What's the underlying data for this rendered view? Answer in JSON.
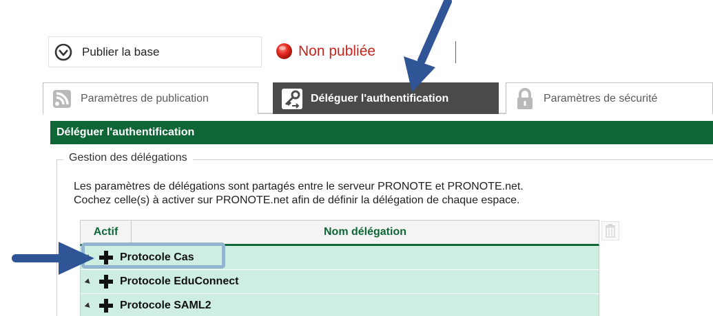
{
  "publish": {
    "button_label": "Publier la base",
    "status_label": "Non publiée",
    "status_color": "#c8241c"
  },
  "tabs": [
    {
      "label": "Paramètres de publication",
      "icon": "rss-feed-icon",
      "active": false
    },
    {
      "label": "Déléguer l'authentification",
      "icon": "key-delegate-icon",
      "active": true
    },
    {
      "label": "Paramètres de sécurité",
      "icon": "lock-icon",
      "active": false
    }
  ],
  "section": {
    "title": "Déléguer l'authentification",
    "accent_color": "#0e6637"
  },
  "fieldset": {
    "legend": "Gestion des délégations",
    "description_line1": "Les paramètres de délégations sont partagés entre le serveur PRONOTE et PRONOTE.net.",
    "description_line2": "Cochez celle(s) à activer sur PRONOTE.net afin de définir la délégation de chaque espace."
  },
  "table": {
    "columns": [
      "Actif",
      "Nom délégation"
    ],
    "rows": [
      {
        "label": "Protocole Cas"
      },
      {
        "label": "Protocole EduConnect"
      },
      {
        "label": "Protocole SAML2"
      }
    ]
  }
}
